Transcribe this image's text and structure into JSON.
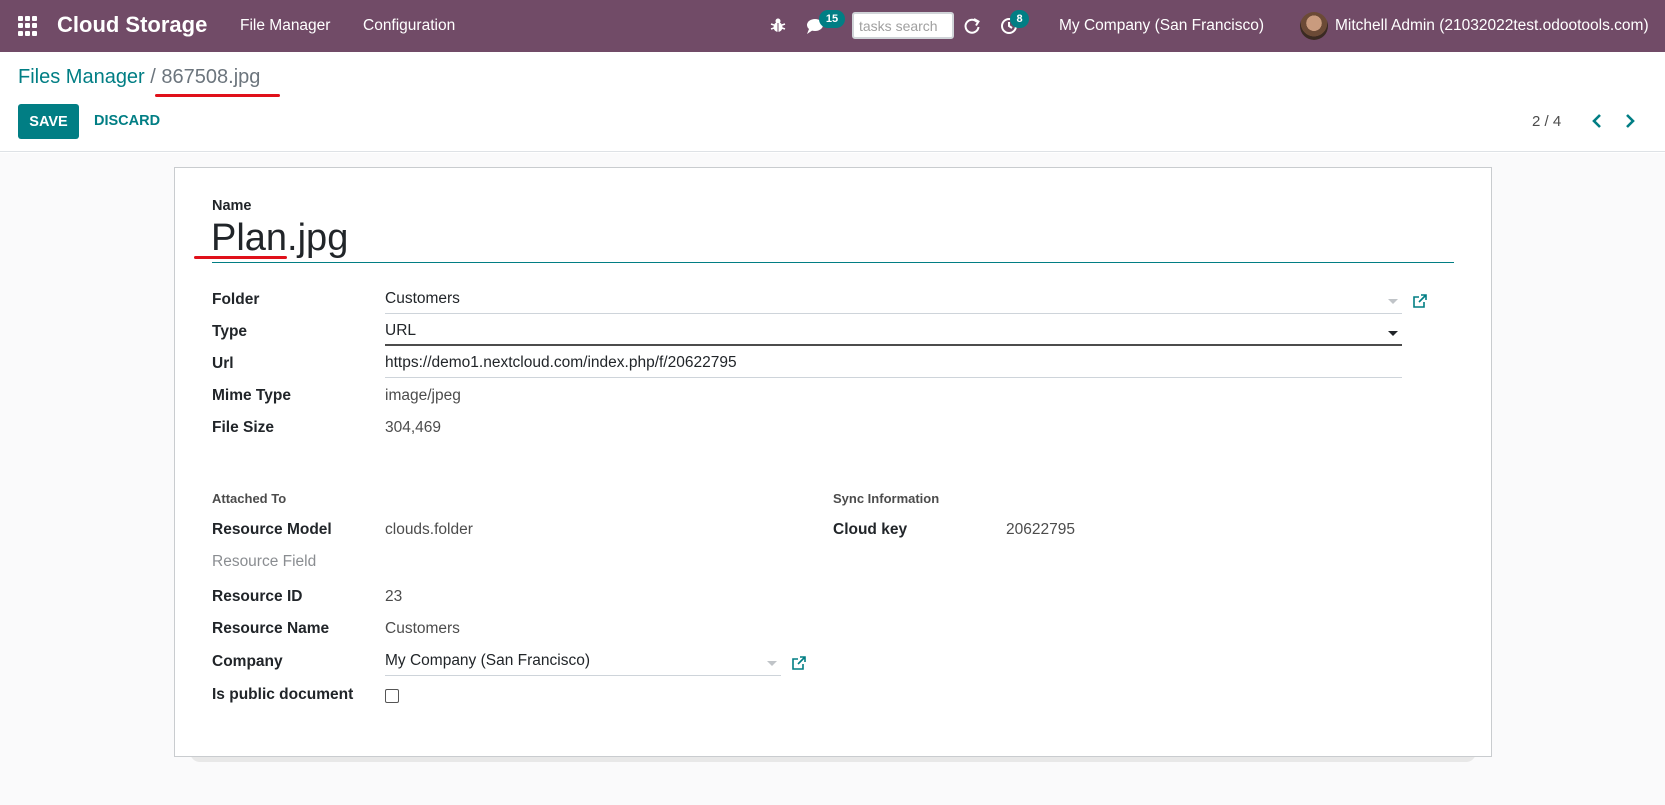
{
  "navbar": {
    "brand": "Cloud Storage",
    "menu": [
      "File Manager",
      "Configuration"
    ],
    "messages_count": "15",
    "search_placeholder": "tasks search",
    "activities_count": "8",
    "company": "My Company (San Francisco)",
    "user": "Mitchell Admin (21032022test.odootools.com)"
  },
  "breadcrumb": {
    "parent": "Files Manager",
    "separator": "/",
    "current": "867508.jpg"
  },
  "buttons": {
    "save": "SAVE",
    "discard": "DISCARD"
  },
  "pager": {
    "value": "2 / 4"
  },
  "form": {
    "name_label": "Name",
    "name_value": "Plan.jpg",
    "fields": {
      "folder": {
        "label": "Folder",
        "value": "Customers"
      },
      "type": {
        "label": "Type",
        "value": "URL"
      },
      "url": {
        "label": "Url",
        "value": "https://demo1.nextcloud.com/index.php/f/20622795"
      },
      "mime_type": {
        "label": "Mime Type",
        "value": "image/jpeg"
      },
      "file_size": {
        "label": "File Size",
        "value": "304,469"
      }
    },
    "attached": {
      "title": "Attached To",
      "resource_model": {
        "label": "Resource Model",
        "value": "clouds.folder"
      },
      "resource_field": {
        "label": "Resource Field",
        "value": ""
      },
      "resource_id": {
        "label": "Resource ID",
        "value": "23"
      },
      "resource_name": {
        "label": "Resource Name",
        "value": "Customers"
      },
      "company": {
        "label": "Company",
        "value": "My Company (San Francisco)"
      },
      "is_public": {
        "label": "Is public document",
        "checked": false
      }
    },
    "sync": {
      "title": "Sync Information",
      "cloud_key": {
        "label": "Cloud key",
        "value": "20622795"
      }
    }
  },
  "colors": {
    "navbar": "#714b67",
    "primary": "#017e84",
    "annotation_red": "#e0101a"
  },
  "icons": [
    "apps-icon",
    "bug-icon",
    "chat-icon",
    "refresh-icon",
    "activity-icon",
    "avatar",
    "chevron-left-icon",
    "chevron-right-icon",
    "external-link-icon"
  ]
}
